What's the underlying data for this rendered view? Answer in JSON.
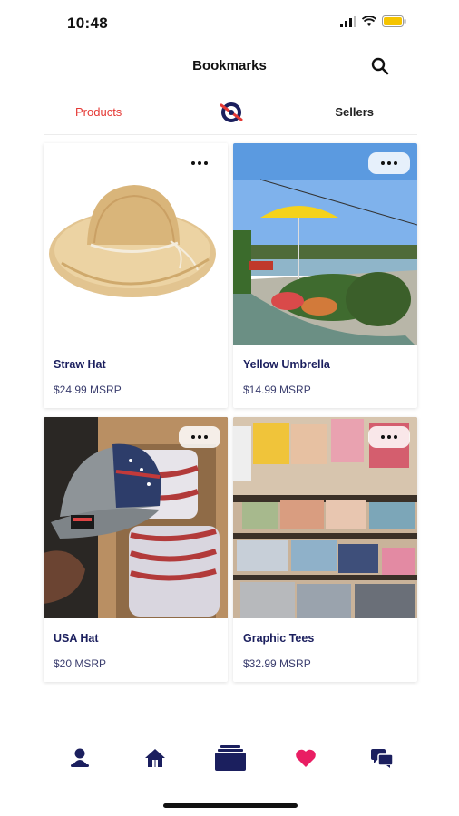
{
  "status": {
    "time": "10:48"
  },
  "header": {
    "title": "Bookmarks",
    "search_icon": "search-icon"
  },
  "tabs": {
    "products": "Products",
    "sellers": "Sellers",
    "logo_icon": "brand-logo-icon"
  },
  "colors": {
    "accent": "#e53935",
    "navy": "#1b1f5e",
    "heart": "#e91e63"
  },
  "products": [
    {
      "title": "Straw Hat",
      "price": "$24.99 MSRP",
      "image": "straw-hat-photo"
    },
    {
      "title": "Yellow Umbrella",
      "price": "$14.99 MSRP",
      "image": "yellow-umbrella-photo"
    },
    {
      "title": "USA Hat",
      "price": "$20 MSRP",
      "image": "usa-hat-photo"
    },
    {
      "title": "Graphic Tees",
      "price": "$32.99 MSRP",
      "image": "graphic-tees-photo"
    }
  ],
  "bottom_nav": [
    {
      "icon": "profile-icon"
    },
    {
      "icon": "home-icon"
    },
    {
      "icon": "bookmarks-icon"
    },
    {
      "icon": "heart-icon"
    },
    {
      "icon": "chat-icon"
    }
  ]
}
